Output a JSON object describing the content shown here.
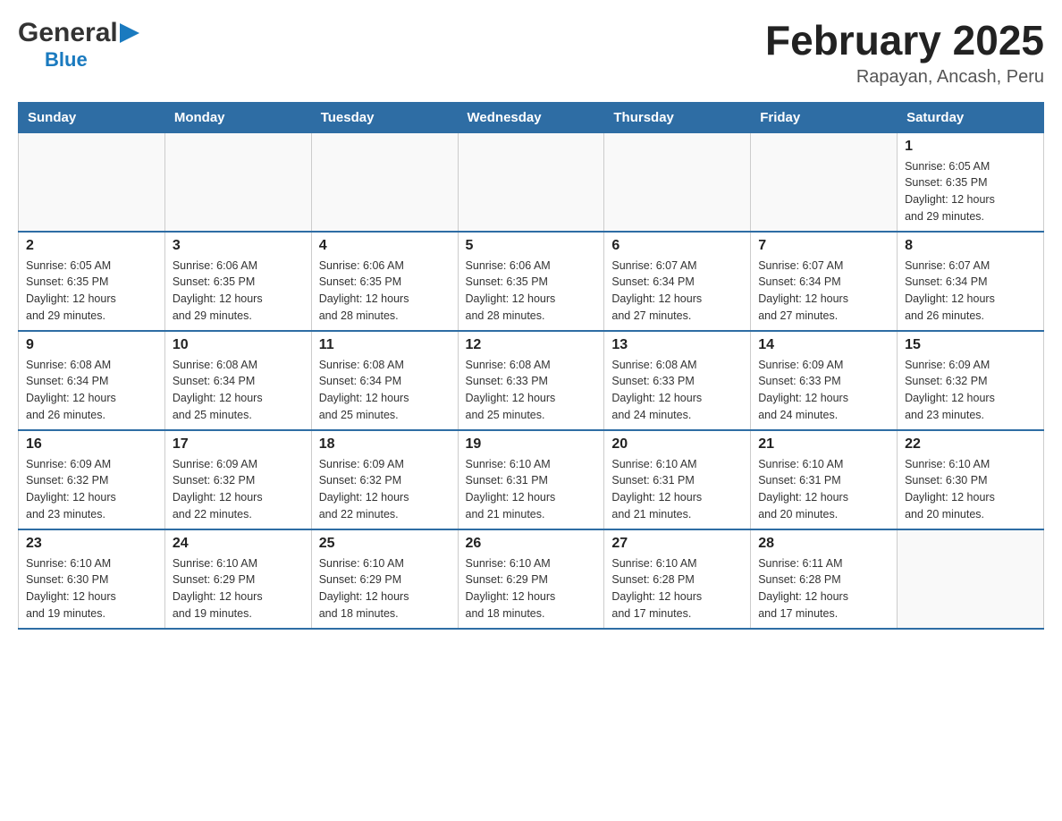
{
  "header": {
    "logo_general": "General",
    "logo_blue": "Blue",
    "month_title": "February 2025",
    "location": "Rapayan, Ancash, Peru"
  },
  "days_of_week": [
    "Sunday",
    "Monday",
    "Tuesday",
    "Wednesday",
    "Thursday",
    "Friday",
    "Saturday"
  ],
  "weeks": [
    {
      "days": [
        {
          "number": "",
          "info": ""
        },
        {
          "number": "",
          "info": ""
        },
        {
          "number": "",
          "info": ""
        },
        {
          "number": "",
          "info": ""
        },
        {
          "number": "",
          "info": ""
        },
        {
          "number": "",
          "info": ""
        },
        {
          "number": "1",
          "info": "Sunrise: 6:05 AM\nSunset: 6:35 PM\nDaylight: 12 hours\nand 29 minutes."
        }
      ]
    },
    {
      "days": [
        {
          "number": "2",
          "info": "Sunrise: 6:05 AM\nSunset: 6:35 PM\nDaylight: 12 hours\nand 29 minutes."
        },
        {
          "number": "3",
          "info": "Sunrise: 6:06 AM\nSunset: 6:35 PM\nDaylight: 12 hours\nand 29 minutes."
        },
        {
          "number": "4",
          "info": "Sunrise: 6:06 AM\nSunset: 6:35 PM\nDaylight: 12 hours\nand 28 minutes."
        },
        {
          "number": "5",
          "info": "Sunrise: 6:06 AM\nSunset: 6:35 PM\nDaylight: 12 hours\nand 28 minutes."
        },
        {
          "number": "6",
          "info": "Sunrise: 6:07 AM\nSunset: 6:34 PM\nDaylight: 12 hours\nand 27 minutes."
        },
        {
          "number": "7",
          "info": "Sunrise: 6:07 AM\nSunset: 6:34 PM\nDaylight: 12 hours\nand 27 minutes."
        },
        {
          "number": "8",
          "info": "Sunrise: 6:07 AM\nSunset: 6:34 PM\nDaylight: 12 hours\nand 26 minutes."
        }
      ]
    },
    {
      "days": [
        {
          "number": "9",
          "info": "Sunrise: 6:08 AM\nSunset: 6:34 PM\nDaylight: 12 hours\nand 26 minutes."
        },
        {
          "number": "10",
          "info": "Sunrise: 6:08 AM\nSunset: 6:34 PM\nDaylight: 12 hours\nand 25 minutes."
        },
        {
          "number": "11",
          "info": "Sunrise: 6:08 AM\nSunset: 6:34 PM\nDaylight: 12 hours\nand 25 minutes."
        },
        {
          "number": "12",
          "info": "Sunrise: 6:08 AM\nSunset: 6:33 PM\nDaylight: 12 hours\nand 25 minutes."
        },
        {
          "number": "13",
          "info": "Sunrise: 6:08 AM\nSunset: 6:33 PM\nDaylight: 12 hours\nand 24 minutes."
        },
        {
          "number": "14",
          "info": "Sunrise: 6:09 AM\nSunset: 6:33 PM\nDaylight: 12 hours\nand 24 minutes."
        },
        {
          "number": "15",
          "info": "Sunrise: 6:09 AM\nSunset: 6:32 PM\nDaylight: 12 hours\nand 23 minutes."
        }
      ]
    },
    {
      "days": [
        {
          "number": "16",
          "info": "Sunrise: 6:09 AM\nSunset: 6:32 PM\nDaylight: 12 hours\nand 23 minutes."
        },
        {
          "number": "17",
          "info": "Sunrise: 6:09 AM\nSunset: 6:32 PM\nDaylight: 12 hours\nand 22 minutes."
        },
        {
          "number": "18",
          "info": "Sunrise: 6:09 AM\nSunset: 6:32 PM\nDaylight: 12 hours\nand 22 minutes."
        },
        {
          "number": "19",
          "info": "Sunrise: 6:10 AM\nSunset: 6:31 PM\nDaylight: 12 hours\nand 21 minutes."
        },
        {
          "number": "20",
          "info": "Sunrise: 6:10 AM\nSunset: 6:31 PM\nDaylight: 12 hours\nand 21 minutes."
        },
        {
          "number": "21",
          "info": "Sunrise: 6:10 AM\nSunset: 6:31 PM\nDaylight: 12 hours\nand 20 minutes."
        },
        {
          "number": "22",
          "info": "Sunrise: 6:10 AM\nSunset: 6:30 PM\nDaylight: 12 hours\nand 20 minutes."
        }
      ]
    },
    {
      "days": [
        {
          "number": "23",
          "info": "Sunrise: 6:10 AM\nSunset: 6:30 PM\nDaylight: 12 hours\nand 19 minutes."
        },
        {
          "number": "24",
          "info": "Sunrise: 6:10 AM\nSunset: 6:29 PM\nDaylight: 12 hours\nand 19 minutes."
        },
        {
          "number": "25",
          "info": "Sunrise: 6:10 AM\nSunset: 6:29 PM\nDaylight: 12 hours\nand 18 minutes."
        },
        {
          "number": "26",
          "info": "Sunrise: 6:10 AM\nSunset: 6:29 PM\nDaylight: 12 hours\nand 18 minutes."
        },
        {
          "number": "27",
          "info": "Sunrise: 6:10 AM\nSunset: 6:28 PM\nDaylight: 12 hours\nand 17 minutes."
        },
        {
          "number": "28",
          "info": "Sunrise: 6:11 AM\nSunset: 6:28 PM\nDaylight: 12 hours\nand 17 minutes."
        },
        {
          "number": "",
          "info": ""
        }
      ]
    }
  ]
}
